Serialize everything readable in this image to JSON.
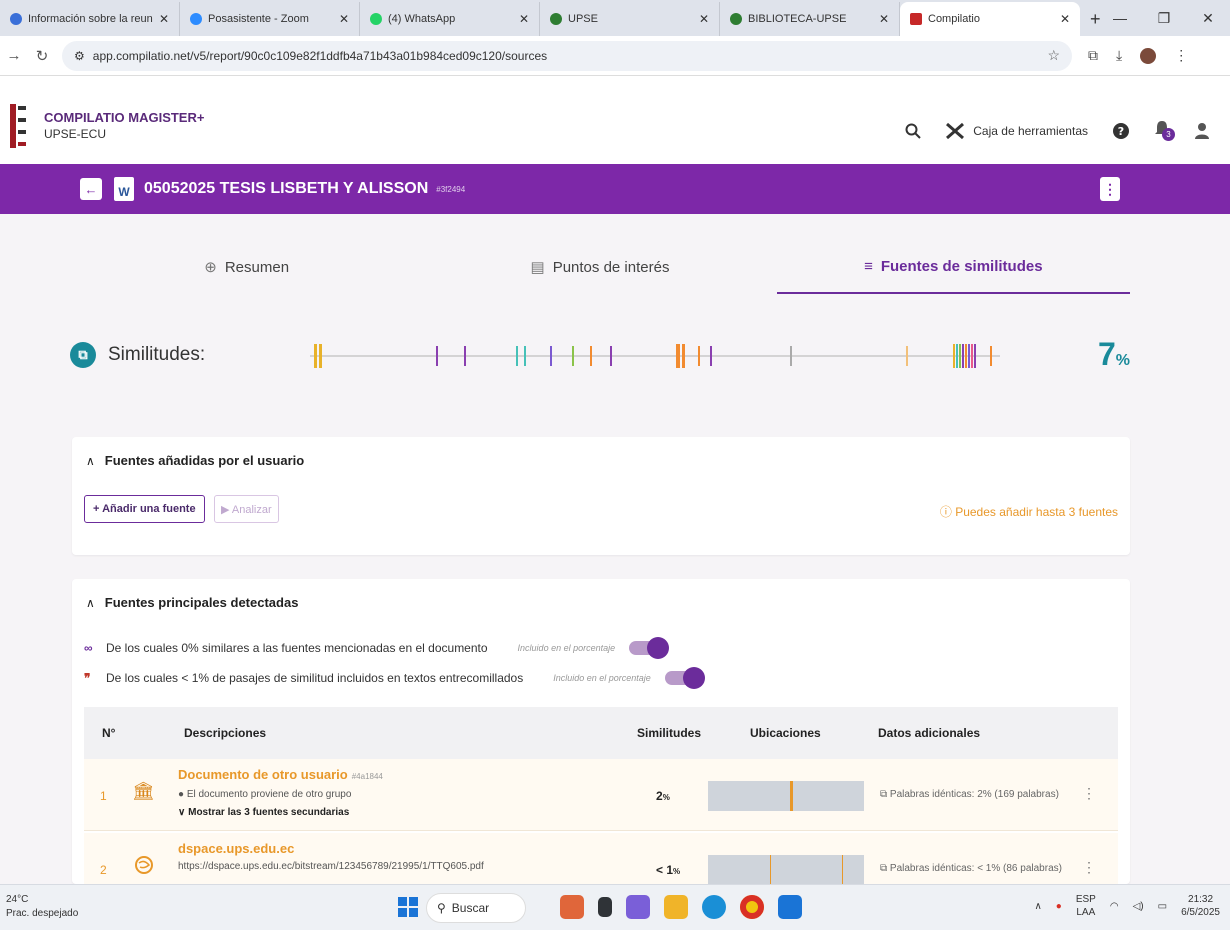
{
  "browser": {
    "tabs": [
      {
        "label": "Información sobre la reuni",
        "color": "#3a6fd8",
        "active": false
      },
      {
        "label": "Posasistente - Zoom",
        "color": "#2d8cff",
        "active": false
      },
      {
        "label": "(4) WhatsApp",
        "color": "#25d366",
        "active": false
      },
      {
        "label": "UPSE",
        "color": "#2e7d32",
        "active": false
      },
      {
        "label": "BIBLIOTECA-UPSE",
        "color": "#2e7d32",
        "active": false
      },
      {
        "label": "Compilatio",
        "color": "#c62828",
        "active": true
      }
    ],
    "url": "app.compilatio.net/v5/report/90c0c109e82f1ddfb4a71b43a01b984ced09c120/sources"
  },
  "header": {
    "brand_title": "COMPILATIO MAGISTER+",
    "brand_sub": "UPSE-ECU",
    "tools_label": "Caja de herramientas",
    "notifications_count": "3"
  },
  "document": {
    "title": "05052025 TESIS LISBETH Y ALISSON",
    "id": "#3f2494"
  },
  "nav_tabs": [
    {
      "label": "Resumen",
      "icon": "magnifier-icon",
      "active": false
    },
    {
      "label": "Puntos de interés",
      "icon": "document-icon",
      "active": false
    },
    {
      "label": "Fuentes de similitudes",
      "icon": "list-icon",
      "active": true
    }
  ],
  "similarity": {
    "label": "Similitudes:",
    "percent": "7",
    "percent_unit": "%",
    "accent": "#1a8a9a"
  },
  "user_sources": {
    "title": "Fuentes añadidas por el usuario",
    "add_button": "+ Añadir una fuente",
    "analyze_button": "▶ Analizar",
    "hint": "ⓘ Puedes añadir hasta 3 fuentes"
  },
  "main_sources": {
    "title": "Fuentes principales detectadas",
    "toggle1_text": "De los cuales 0% similares a las fuentes mencionadas en el documento",
    "toggle1_included": "Incluido en el porcentaje",
    "toggle2_text": "De los cuales < 1% de pasajes de similitud incluidos en textos entrecomillados",
    "toggle2_included": "Incluido en el porcentaje",
    "columns": {
      "num": "N°",
      "desc": "Descripciones",
      "sim": "Similitudes",
      "loc": "Ubicaciones",
      "extra": "Datos adicionales"
    },
    "rows": [
      {
        "num": "1",
        "title": "Documento de otro usuario",
        "id": "#4a1844",
        "sub": "El documento proviene de otro grupo",
        "more": "Mostrar las 3 fuentes secundarias",
        "pct": "2",
        "pct_unit": "%",
        "extra": "Palabras idénticas: 2% (169 palabras)"
      },
      {
        "num": "2",
        "title": "dspace.ups.edu.ec",
        "id": "",
        "sub": "https://dspace.ups.edu.ec/bitstream/123456789/21995/1/TTQ605.pdf",
        "more": "",
        "pct": "< 1",
        "pct_unit": "%",
        "extra": "Palabras idénticas: < 1% (86 palabras)"
      }
    ]
  },
  "taskbar": {
    "temp": "24°C",
    "weather": "Prac. despejado",
    "search": "Buscar",
    "lang1": "ESP",
    "lang2": "LAA",
    "time": "21:32",
    "date": "6/5/2025"
  }
}
